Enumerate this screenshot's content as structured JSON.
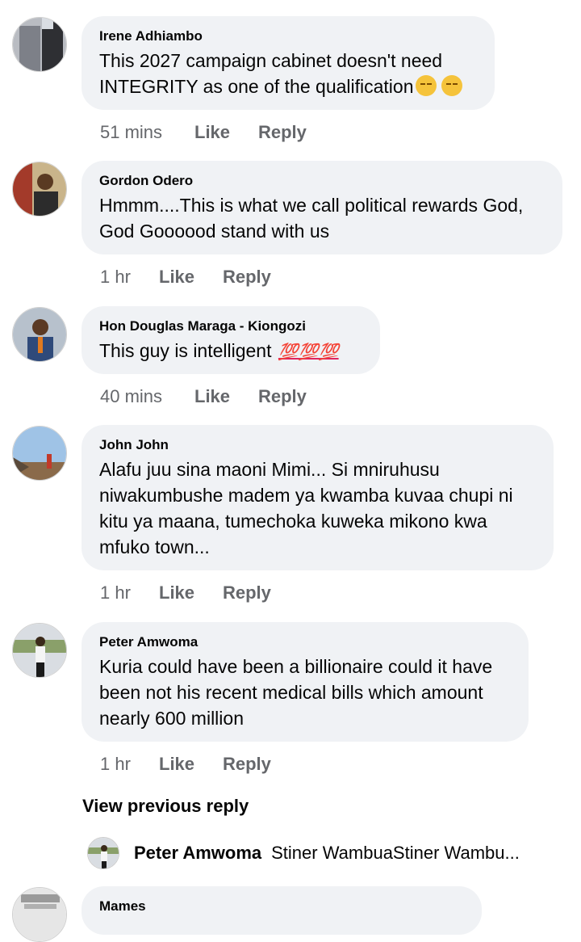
{
  "comments": [
    {
      "author": "Irene Adhiambo",
      "text": "This 2027 campaign cabinet doesn't need INTEGRITY as one of the qualification",
      "emoji": "pensive-face pensive-face",
      "time": "51 mins",
      "like": "Like",
      "reply": "Reply"
    },
    {
      "author": "Gordon Odero",
      "text": "Hmmm....This is what we call political rewards God, God Goooood stand with us",
      "time": "1 hr",
      "like": "Like",
      "reply": "Reply"
    },
    {
      "author": "Hon Douglas Maraga - Kiongozi",
      "text": "This guy is intelligent",
      "hundreds": "💯💯💯",
      "time": "40 mins",
      "like": "Like",
      "reply": "Reply"
    },
    {
      "author": "John John",
      "text": "Alafu juu sina maoni Mimi... Si mniruhusu niwakumbushe madem  ya kwamba kuvaa chupi ni kitu ya maana, tumechoka kuweka mikono kwa mfuko town...",
      "time": "1 hr",
      "like": "Like",
      "reply": "Reply"
    },
    {
      "author": "Peter Amwoma",
      "text": "Kuria could have been a billionaire could it have been not his recent medical bills which amount nearly 600 million",
      "time": "1 hr",
      "like": "Like",
      "reply": "Reply"
    }
  ],
  "view_previous": "View previous reply",
  "reply_preview": {
    "author": "Peter Amwoma",
    "snippet": "Stiner WambuaStiner Wambu..."
  },
  "partial_comment": {
    "author": "Mames"
  }
}
